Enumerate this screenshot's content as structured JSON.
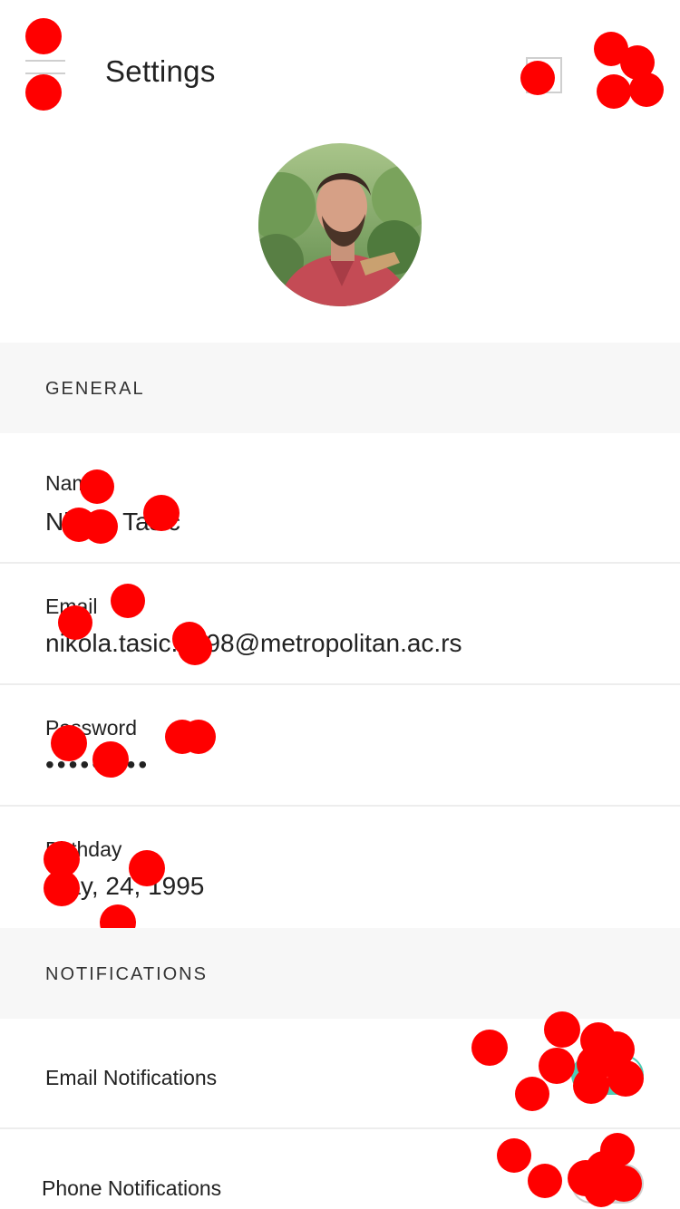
{
  "header": {
    "title": "Settings",
    "menu_icon": "hamburger-menu-icon",
    "square_icon": "square-icon",
    "more_icon": "more-icon"
  },
  "profile": {
    "avatar_alt": "profile photo of a bearded man in a red shirt"
  },
  "sections": {
    "general": "GENERAL",
    "notifications": "NOTIFICATIONS"
  },
  "general": {
    "name_label": "Name",
    "name_value": "Nikola Tasic",
    "email_label": "Email",
    "email_value": "nikola.tasic.1998@metropolitan.ac.rs",
    "password_label": "Password",
    "password_value": "•••••••••",
    "birthday_label": "Birthday",
    "birthday_value": "May, 24, 1995"
  },
  "notifications": {
    "email_label": "Email Notifications",
    "email_enabled": true,
    "phone_label": "Phone Notifications",
    "phone_enabled": false
  },
  "colors": {
    "accent": "#4ecdb6",
    "marker": "#ff0000",
    "section_bg": "#f7f7f7"
  }
}
